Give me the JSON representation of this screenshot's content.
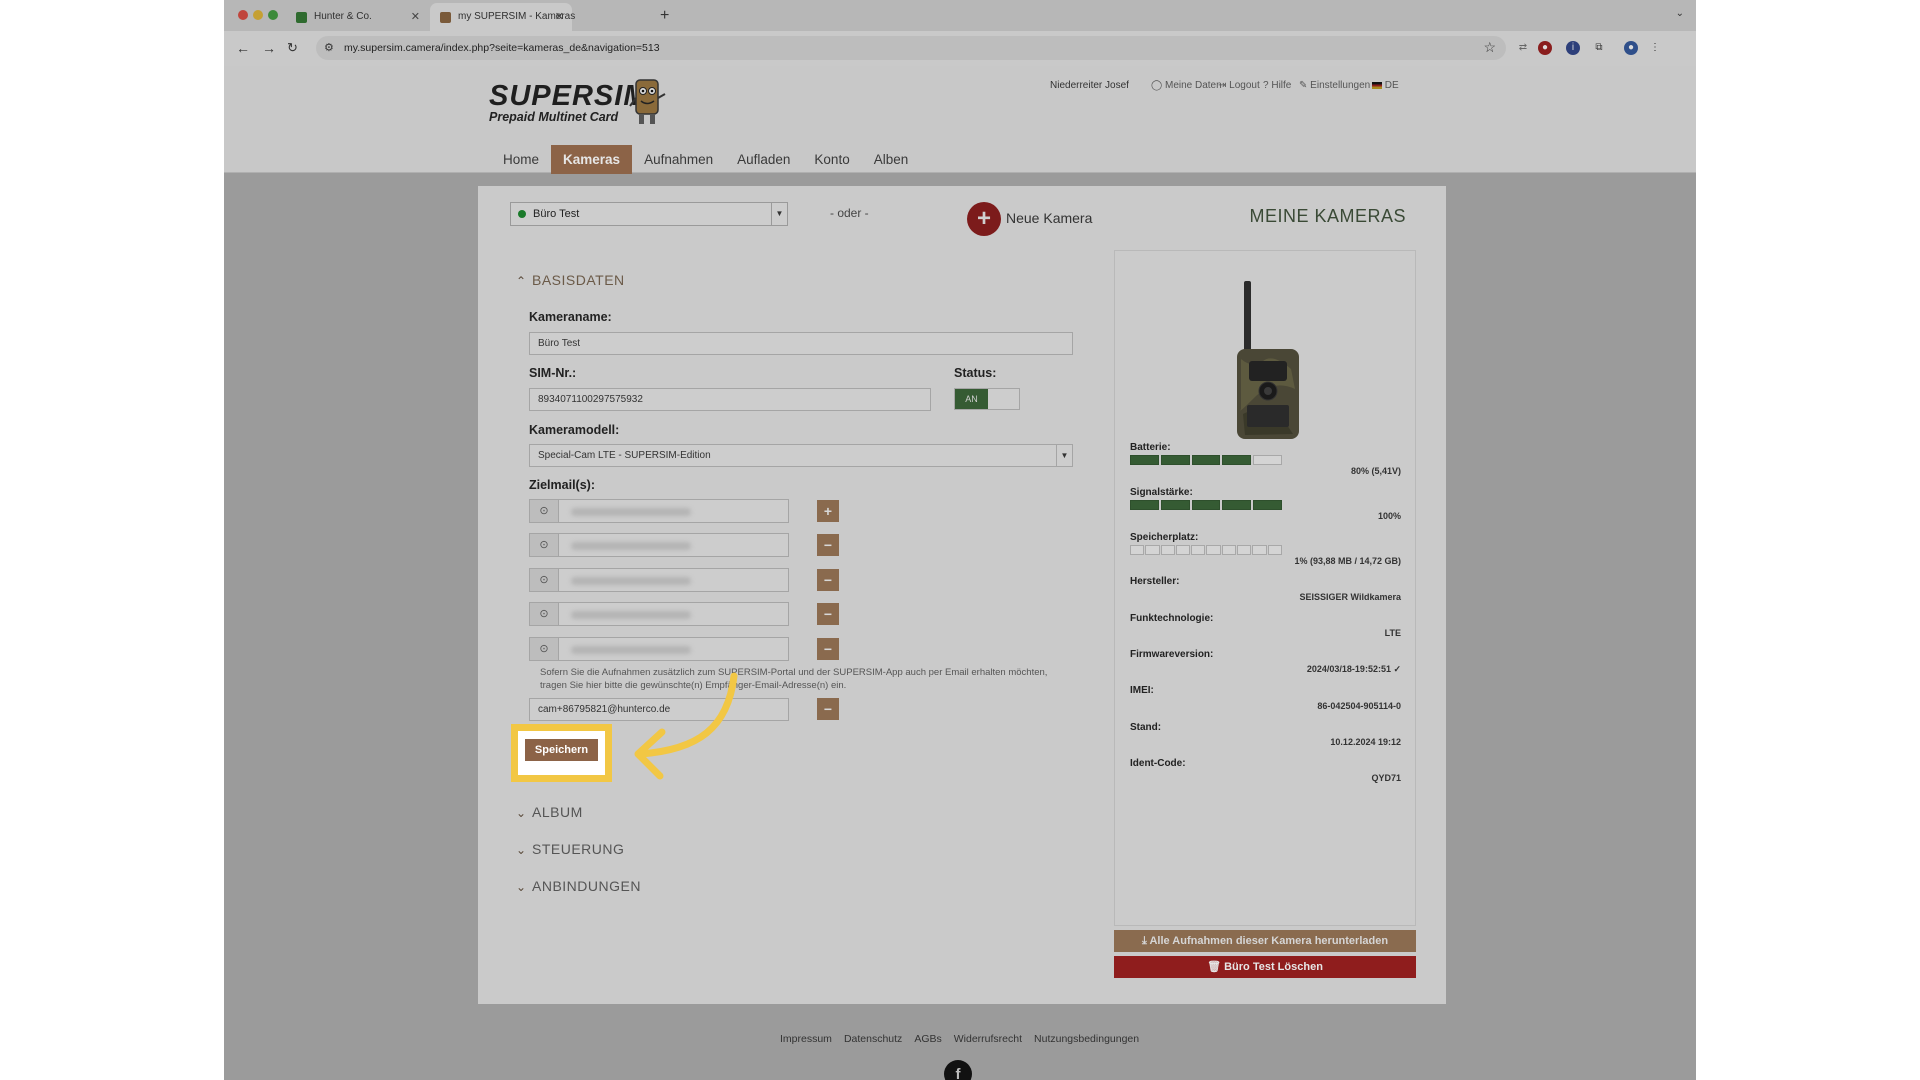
{
  "browser": {
    "tabs": [
      {
        "title": "Hunter & Co.",
        "active": false,
        "favicon_color": "#2f6b2f"
      },
      {
        "title": "my SUPERSIM - Kameras",
        "active": true,
        "favicon_color": "#7a5a3a"
      }
    ],
    "new_tab": "+",
    "url": "my.supersim.camera/index.php?seite=kameras_de&navigation=513"
  },
  "header": {
    "logo_line1": "SUPERSIM",
    "logo_line2": "Prepaid Multinet Card",
    "user_name": "Niederreiter Josef",
    "links": {
      "meine_daten": "Meine Daten",
      "logout": "Logout",
      "hilfe": "Hilfe",
      "einstellungen": "Einstellungen",
      "language": "DE"
    },
    "nav": [
      "Home",
      "Kameras",
      "Aufnahmen",
      "Aufladen",
      "Konto",
      "Alben"
    ],
    "active_nav": "Kameras"
  },
  "toolbar": {
    "selected_camera": "Büro Test",
    "oder": "- oder -",
    "new_camera_label": "Neue Kamera",
    "section_title": "MEINE KAMERAS"
  },
  "form": {
    "section_basis": "BASISDATEN",
    "kameraname_label": "Kameraname:",
    "kameraname_value": "Büro Test",
    "sim_label": "SIM-Nr.:",
    "sim_value": "8934071100297575932",
    "status_label": "Status:",
    "status_value": "AN",
    "modell_label": "Kameramodell:",
    "modell_value": "Special-Cam LTE - SUPERSIM-Edition",
    "zielmail_label": "Zielmail(s):",
    "hint": "Sofern Sie die Aufnahmen zusätzlich zum SUPERSIM-Portal und der SUPERSIM-App auch per Email erhalten möchten, tragen Sie hier bitte die gewünschte(n) Empfänger-Email-Adresse(n) ein.",
    "extra_mail": "cam+86795821@hunterco.de",
    "save_label": "Speichern",
    "section_album": "ALBUM",
    "section_steuerung": "STEUERUNG",
    "section_anbindungen": "ANBINDUNGEN"
  },
  "panel": {
    "batterie_label": "Batterie:",
    "batterie_value": "80% (5,41V)",
    "batterie_level": 0.8,
    "signal_label": "Signalstärke:",
    "signal_value": "100%",
    "signal_level": 1.0,
    "speicher_label": "Speicherplatz:",
    "speicher_value": "1% (93,88 MB / 14,72 GB)",
    "speicher_level": 0.01,
    "hersteller_label": "Hersteller:",
    "hersteller_value": "SEISSIGER Wildkamera",
    "funk_label": "Funktechnologie:",
    "funk_value": "LTE",
    "firmware_label": "Firmwareversion:",
    "firmware_value": "2024/03/18-19:52:51 ✓",
    "imei_label": "IMEI:",
    "imei_value": "86-042504-905114-0",
    "stand_label": "Stand:",
    "stand_value": "10.12.2024 19:12",
    "ident_label": "Ident-Code:",
    "ident_value": "QYD71",
    "download_label": "Alle Aufnahmen dieser Kamera herunterladen",
    "delete_label": "Büro Test Löschen"
  },
  "footer": {
    "links": [
      "Impressum",
      "Datenschutz",
      "AGBs",
      "Widerrufsrecht",
      "Nutzungsbedingungen"
    ],
    "facebook": "f"
  },
  "colors": {
    "accent_brown": "#8c6347",
    "status_green": "#355b33",
    "delete_red": "#8f1d1d",
    "highlight_yellow": "#f2c744"
  }
}
